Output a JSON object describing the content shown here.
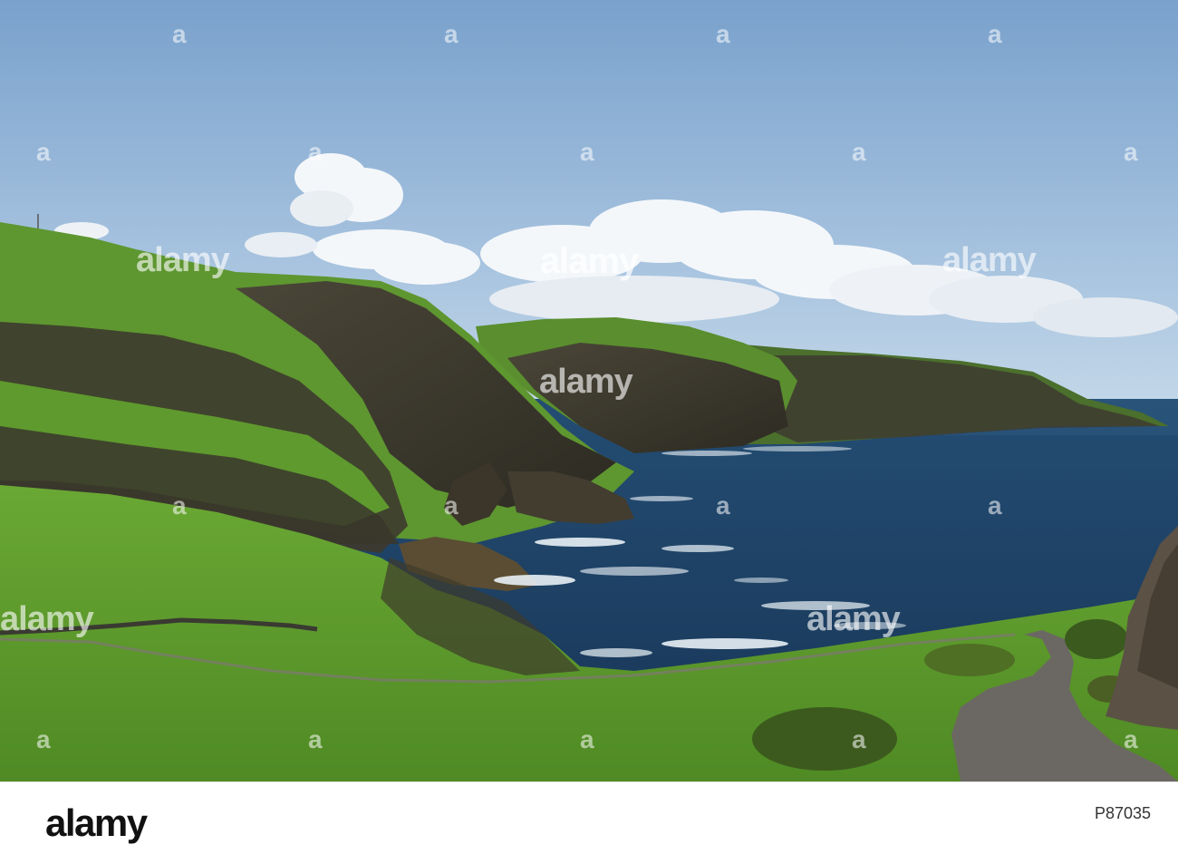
{
  "watermark": {
    "brand": "alamy",
    "glyph": "a"
  },
  "footer": {
    "logo_text": "alamy",
    "image_id": "P87035"
  },
  "scene": {
    "description_tags": [
      "sky",
      "clouds",
      "cliffs",
      "sea",
      "grass",
      "road"
    ],
    "colors": {
      "sky_top": "#7fa6cf",
      "sky_bottom": "#bcd3e6",
      "sea": "#1d4266",
      "grass": "#5f9a2e",
      "cliff": "#3f3b30",
      "road": "#6a6763"
    }
  }
}
